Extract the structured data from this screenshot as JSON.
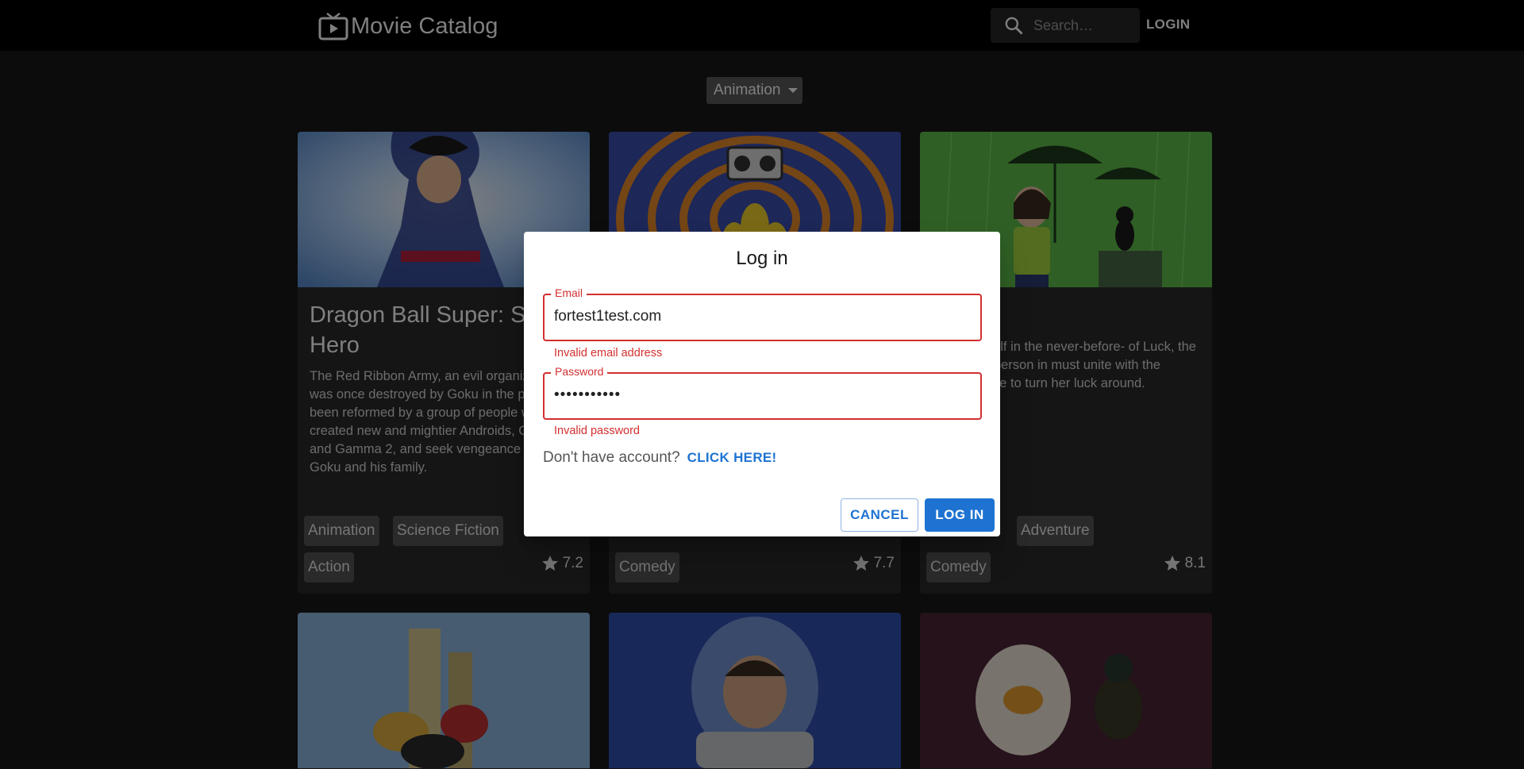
{
  "header": {
    "app_title": "Movie Catalog",
    "search_placeholder": "Search…",
    "login_label": "LOGIN"
  },
  "filter": {
    "genre_selected": "Animation"
  },
  "cards": [
    {
      "title": "Dragon Ball Super: Super Hero",
      "description": "The Red Ribbon Army, an evil organization that was once destroyed by Goku in the past, has been reformed by a group of people who have created new and mightier Androids, Gamma 1 and Gamma 2, and seek vengeance against Goku and his family.",
      "genres": [
        "Animation",
        "Science Fiction",
        "Action"
      ],
      "rating": "7.2"
    },
    {
      "title": "",
      "description": "",
      "genres": [
        "",
        "",
        "Comedy"
      ],
      "rating": "7.7"
    },
    {
      "title": "",
      "description": "nding herself in the never-before- of Luck, the unluckiest person in must unite with the magical here to turn her luck around.",
      "genres": [
        "",
        "Adventure",
        "Comedy"
      ],
      "rating": "8.1"
    }
  ],
  "dialog": {
    "title": "Log in",
    "email_label": "Email",
    "email_value": "fortest1test.com",
    "email_error": "Invalid email address",
    "password_label": "Password",
    "password_value": "•••••••••••",
    "password_error": "Invalid password",
    "signup_prompt": "Don't have account?",
    "signup_link": "CLICK HERE!",
    "cancel_label": "CANCEL",
    "login_label": "LOG IN"
  },
  "colors": {
    "error": "#d32f2f",
    "primary": "#1e73d2",
    "appbar": "#000000",
    "background": "#181818"
  }
}
